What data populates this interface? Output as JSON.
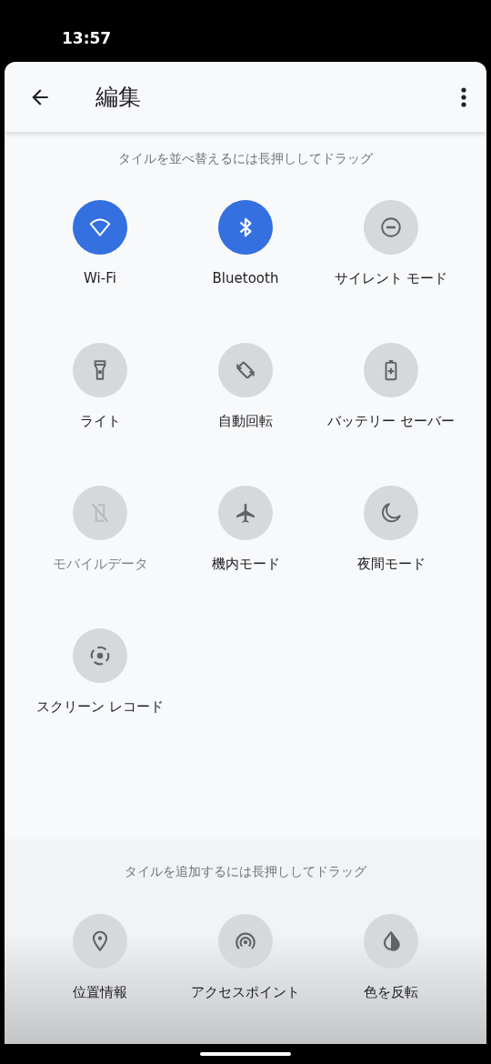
{
  "status_bar": {
    "time": "13:57"
  },
  "header": {
    "title": "編集"
  },
  "active": {
    "hint": "タイルを並べ替えるには長押ししてドラッグ",
    "tiles": [
      {
        "label": "Wi-Fi",
        "on": true,
        "disabled": false
      },
      {
        "label": "Bluetooth",
        "on": true,
        "disabled": false
      },
      {
        "label": "サイレント モード",
        "on": false,
        "disabled": false
      },
      {
        "label": "ライト",
        "on": false,
        "disabled": false
      },
      {
        "label": "自動回転",
        "on": false,
        "disabled": false
      },
      {
        "label": "バッテリー セーバー",
        "on": false,
        "disabled": false
      },
      {
        "label": "モバイルデータ",
        "on": false,
        "disabled": true
      },
      {
        "label": "機内モード",
        "on": false,
        "disabled": false
      },
      {
        "label": "夜間モード",
        "on": false,
        "disabled": false
      },
      {
        "label": "スクリーン レコード",
        "on": false,
        "disabled": false
      }
    ]
  },
  "available": {
    "hint": "タイルを追加するには長押ししてドラッグ",
    "tiles": [
      {
        "label": "位置情報",
        "on": false,
        "disabled": false
      },
      {
        "label": "アクセスポイント",
        "on": false,
        "disabled": false
      },
      {
        "label": "色を反転",
        "on": false,
        "disabled": false
      }
    ]
  }
}
